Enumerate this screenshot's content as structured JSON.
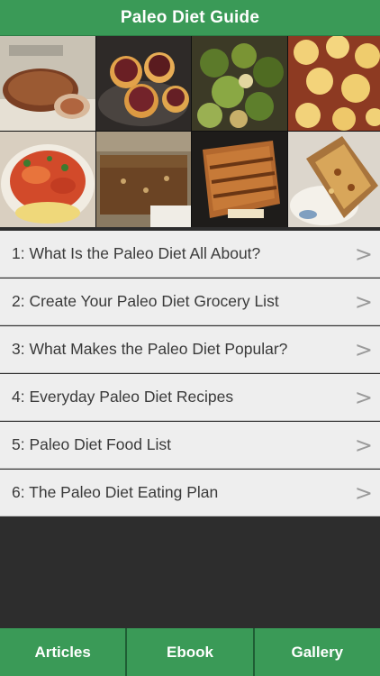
{
  "header": {
    "title": "Paleo Diet Guide"
  },
  "gallery": {
    "images": [
      "bacon-wrapped-roast",
      "stuffed-tomatoes",
      "roasted-brussels-sprouts",
      "shepherds-pie",
      "squash-noodle-bowl",
      "baked-dessert-bars",
      "grilled-sandwich",
      "banana-bread"
    ]
  },
  "articles": [
    {
      "label": "1: What Is the Paleo Diet All About?"
    },
    {
      "label": "2: Create Your Paleo Diet Grocery List"
    },
    {
      "label": "3: What Makes the Paleo Diet Popular?"
    },
    {
      "label": "4: Everyday Paleo Diet Recipes"
    },
    {
      "label": "5: Paleo Diet Food List"
    },
    {
      "label": "6: The Paleo Diet Eating Plan"
    }
  ],
  "chevron": ">",
  "tabs": {
    "articles": "Articles",
    "ebook": "Ebook",
    "gallery": "Gallery"
  },
  "colors": {
    "brand_green": "#3a9a57",
    "list_bg": "#eeeeee",
    "page_bg": "#2d2d2d"
  }
}
